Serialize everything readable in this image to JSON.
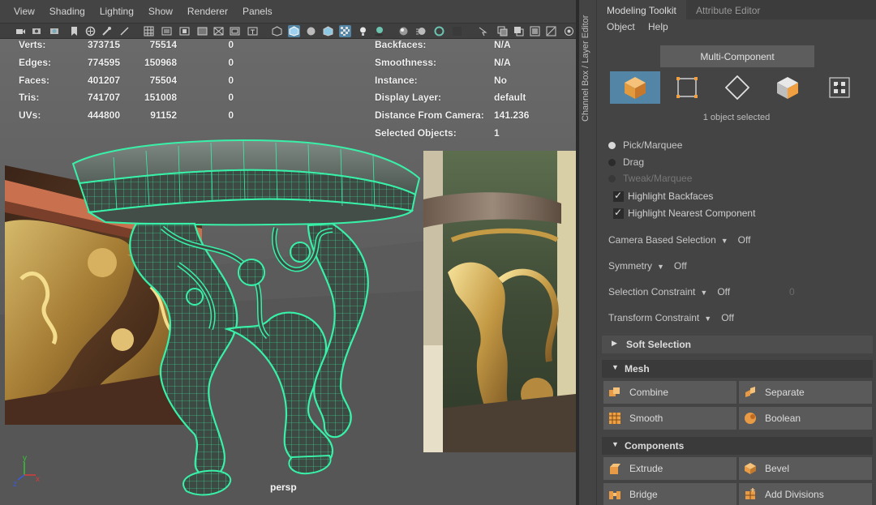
{
  "viewport_menu": [
    "View",
    "Shading",
    "Lighting",
    "Show",
    "Renderer",
    "Panels"
  ],
  "hud": {
    "left_rows": [
      {
        "label": "Verts:",
        "v1": "373715",
        "v2": "75514",
        "v3": "0"
      },
      {
        "label": "Edges:",
        "v1": "774595",
        "v2": "150968",
        "v3": "0"
      },
      {
        "label": "Faces:",
        "v1": "401207",
        "v2": "75504",
        "v3": "0"
      },
      {
        "label": "Tris:",
        "v1": "741707",
        "v2": "151008",
        "v3": "0"
      },
      {
        "label": "UVs:",
        "v1": "444800",
        "v2": "91152",
        "v3": "0"
      }
    ],
    "right_rows": [
      {
        "label": "Backfaces:",
        "value": "N/A"
      },
      {
        "label": "Smoothness:",
        "value": "N/A"
      },
      {
        "label": "Instance:",
        "value": "No"
      },
      {
        "label": "Display Layer:",
        "value": "default"
      },
      {
        "label": "Distance From Camera:",
        "value": "141.236"
      },
      {
        "label": "Selected Objects:",
        "value": "1"
      }
    ]
  },
  "camera_label": "persp",
  "axis": {
    "x": "x",
    "y": "y",
    "z": "z"
  },
  "side_strip_label": "Channel Box / Layer Editor",
  "panel": {
    "tabs": [
      "Modeling Toolkit",
      "Attribute Editor"
    ],
    "menu": [
      "Object",
      "Help"
    ],
    "multi_component": "Multi-Component",
    "mode_icons": [
      "object-mode-icon",
      "vertex-mode-icon",
      "face-mode-icon",
      "edge-mode-icon",
      "uv-mode-icon"
    ],
    "selected_text": "1 object selected",
    "radios": [
      {
        "label": "Pick/Marquee",
        "on": true,
        "disabled": false
      },
      {
        "label": "Drag",
        "on": false,
        "disabled": false
      },
      {
        "label": "Tweak/Marquee",
        "on": false,
        "disabled": true
      }
    ],
    "checks": [
      "Highlight Backfaces",
      "Highlight Nearest Component"
    ],
    "options": [
      {
        "label": "Camera Based Selection",
        "value": "Off",
        "extra": ""
      },
      {
        "label": "Symmetry",
        "value": "Off",
        "extra": ""
      },
      {
        "label": "Selection Constraint",
        "value": "Off",
        "extra": "0"
      },
      {
        "label": "Transform Constraint",
        "value": "Off",
        "extra": ""
      }
    ],
    "sections": {
      "soft_selection": "Soft Selection",
      "mesh": "Mesh",
      "components": "Components"
    },
    "mesh_tools": [
      "Combine",
      "Separate",
      "Smooth",
      "Boolean"
    ],
    "component_tools": [
      "Extrude",
      "Bevel",
      "Bridge",
      "Add Divisions"
    ]
  },
  "colors": {
    "accent": "#5285a6",
    "wireframe": "#39f0a8",
    "panel_bg": "#444444",
    "viewport_bg": "#5d5d5d"
  }
}
